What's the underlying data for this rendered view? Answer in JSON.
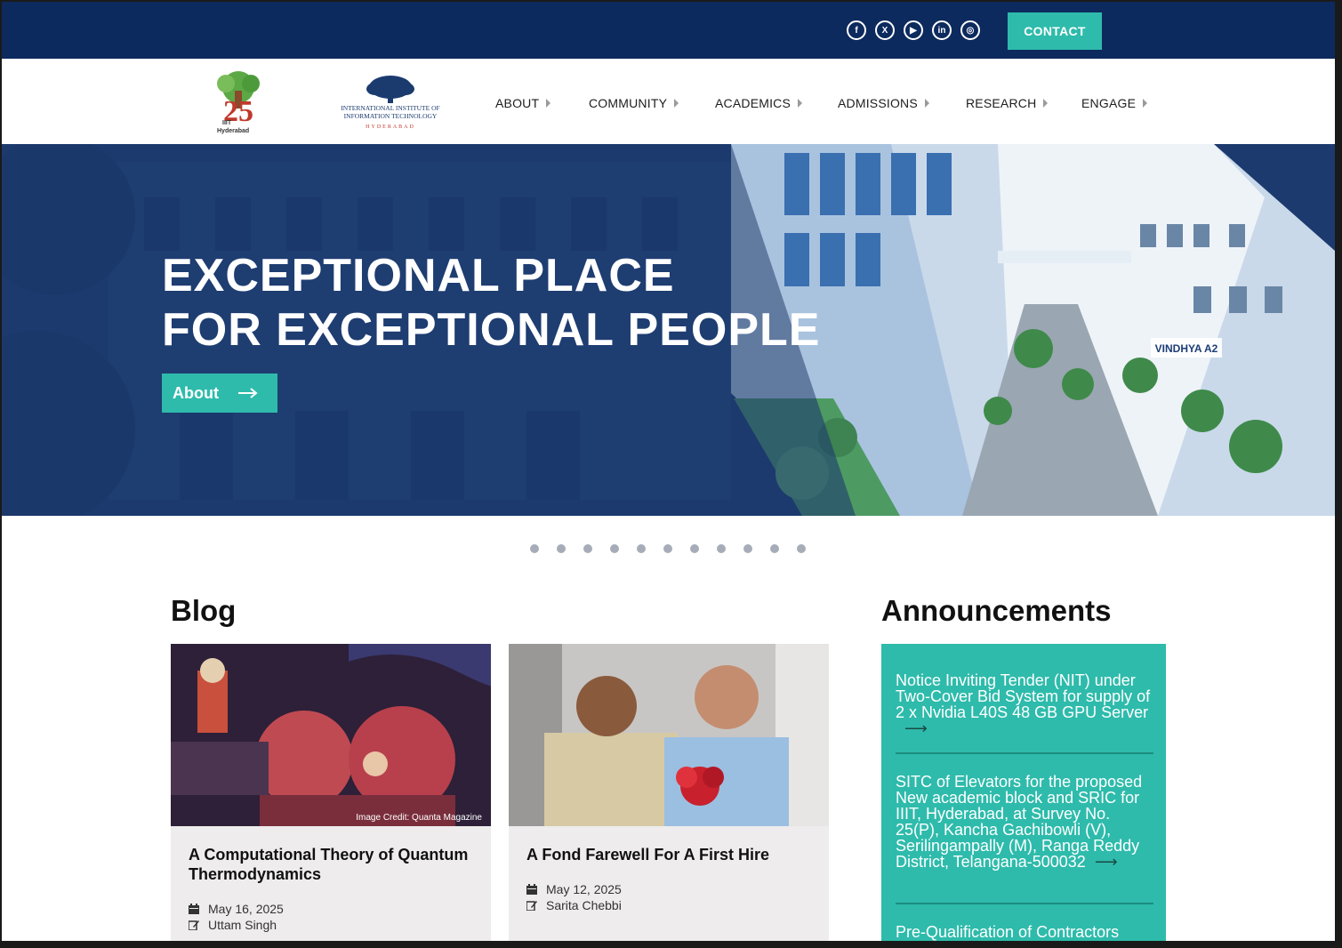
{
  "topbar": {
    "social": [
      {
        "icon": "facebook-icon",
        "glyph": "f"
      },
      {
        "icon": "x-twitter-icon",
        "glyph": "X"
      },
      {
        "icon": "youtube-icon",
        "glyph": "▶"
      },
      {
        "icon": "linkedin-icon",
        "glyph": "in"
      },
      {
        "icon": "instagram-icon",
        "glyph": "◎"
      }
    ],
    "contact_label": "CONTACT"
  },
  "logos": {
    "anniversary_number": "25",
    "anniversary_caption_1": "IIIT",
    "anniversary_caption_2": "Hyderabad",
    "inst_line1": "INTERNATIONAL INSTITUTE OF",
    "inst_line2": "INFORMATION TECHNOLOGY",
    "inst_line3": "HYDERABAD"
  },
  "nav": [
    "ABOUT",
    "COMMUNITY",
    "ACADEMICS",
    "ADMISSIONS",
    "RESEARCH",
    "ENGAGE"
  ],
  "hero": {
    "title": "EXCEPTIONAL PLACE\nFOR EXCEPTIONAL PEOPLE",
    "button_label": "About",
    "building_sign": "VINDHYA A2"
  },
  "carousel": {
    "dot_count": 11
  },
  "blog": {
    "title": "Blog",
    "posts": [
      {
        "title": "A Computational Theory of Quantum Thermodynamics",
        "date": "May 16, 2025",
        "author": "Uttam Singh",
        "image_credit": "Image Credit: Quanta Magazine"
      },
      {
        "title": "A Fond Farewell For A First Hire",
        "date": "May 12, 2025",
        "author": "Sarita Chebbi"
      }
    ]
  },
  "announcements": {
    "title": "Announcements",
    "items": [
      "Notice Inviting Tender (NIT) under Two-Cover Bid System for supply of 2 x Nvidia L40S 48 GB GPU Server",
      "SITC of Elevators for the proposed New academic block and SRIC  for IIIT, Hyderabad, at Survey No. 25(P), Kancha Gachibowli (V), Serilingampally (M), Ranga Reddy District, Telangana-500032",
      "Pre-Qualification of Contractors"
    ]
  },
  "colors": {
    "navy": "#0d2a5e",
    "teal": "#2ebbab"
  }
}
